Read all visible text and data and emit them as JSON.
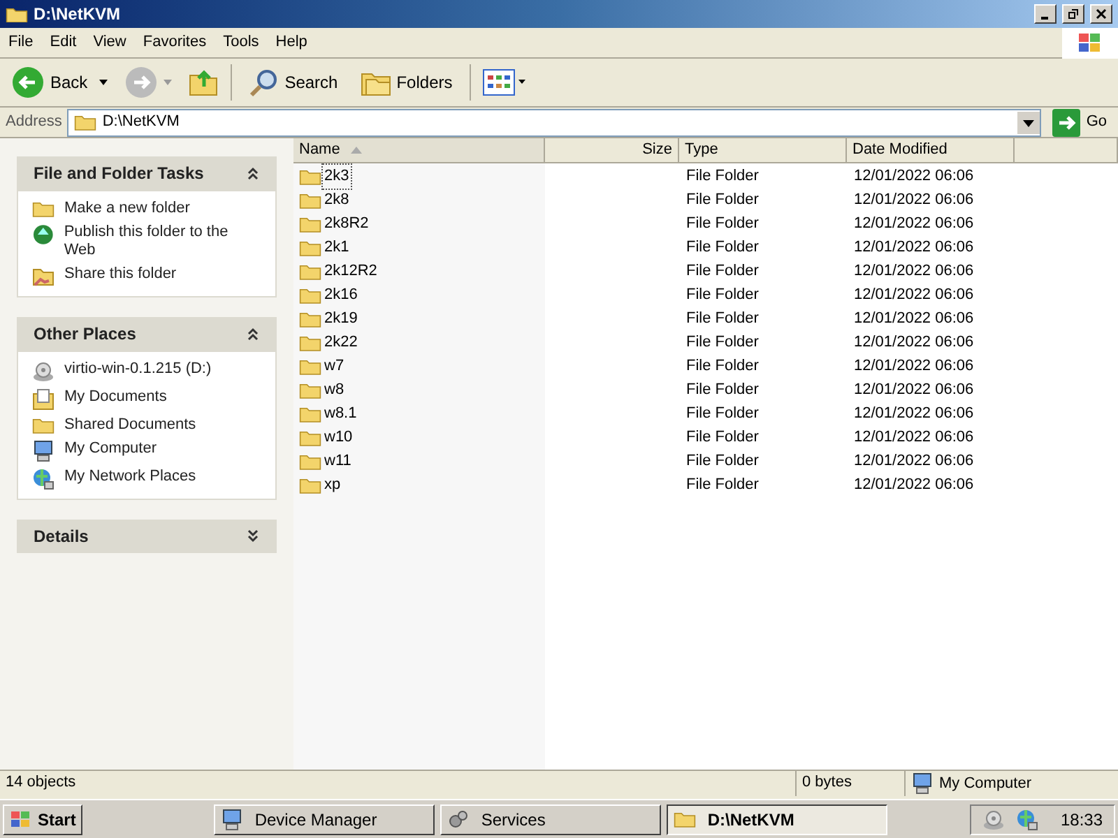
{
  "window": {
    "title": "D:\\NetKVM"
  },
  "menu": [
    "File",
    "Edit",
    "View",
    "Favorites",
    "Tools",
    "Help"
  ],
  "toolbar": {
    "back": "Back",
    "search": "Search",
    "folders": "Folders"
  },
  "address": {
    "label": "Address",
    "value": "D:\\NetKVM",
    "go": "Go"
  },
  "panels": [
    {
      "title": "File and Folder Tasks",
      "expanded": true,
      "items": [
        {
          "label": "Make a new folder",
          "kind": "newfolder"
        },
        {
          "label": "Publish this folder to the Web",
          "kind": "globe"
        },
        {
          "label": "Share this folder",
          "kind": "share"
        }
      ]
    },
    {
      "title": "Other Places",
      "expanded": true,
      "items": [
        {
          "label": "virtio-win-0.1.215 (D:)",
          "kind": "disc"
        },
        {
          "label": "My Documents",
          "kind": "docs"
        },
        {
          "label": "Shared Documents",
          "kind": "folder"
        },
        {
          "label": "My Computer",
          "kind": "computer"
        },
        {
          "label": "My Network Places",
          "kind": "network"
        }
      ]
    },
    {
      "title": "Details",
      "expanded": false
    }
  ],
  "table": {
    "columns": [
      {
        "label": "Name",
        "sorted": true
      },
      {
        "label": "Size",
        "sorted": false
      },
      {
        "label": "Type",
        "sorted": false
      },
      {
        "label": "Date Modified",
        "sorted": false
      }
    ],
    "rows": [
      {
        "name": "2k3",
        "type": "File Folder",
        "date": "12/01/2022 06:06",
        "focused": true
      },
      {
        "name": "2k8",
        "type": "File Folder",
        "date": "12/01/2022 06:06",
        "focused": false
      },
      {
        "name": "2k8R2",
        "type": "File Folder",
        "date": "12/01/2022 06:06",
        "focused": false
      },
      {
        "name": "2k1",
        "type": "File Folder",
        "date": "12/01/2022 06:06",
        "focused": false
      },
      {
        "name": "2k12R2",
        "type": "File Folder",
        "date": "12/01/2022 06:06",
        "focused": false
      },
      {
        "name": "2k16",
        "type": "File Folder",
        "date": "12/01/2022 06:06",
        "focused": false
      },
      {
        "name": "2k19",
        "type": "File Folder",
        "date": "12/01/2022 06:06",
        "focused": false
      },
      {
        "name": "2k22",
        "type": "File Folder",
        "date": "12/01/2022 06:06",
        "focused": false
      },
      {
        "name": "w7",
        "type": "File Folder",
        "date": "12/01/2022 06:06",
        "focused": false
      },
      {
        "name": "w8",
        "type": "File Folder",
        "date": "12/01/2022 06:06",
        "focused": false
      },
      {
        "name": "w8.1",
        "type": "File Folder",
        "date": "12/01/2022 06:06",
        "focused": false
      },
      {
        "name": "w10",
        "type": "File Folder",
        "date": "12/01/2022 06:06",
        "focused": false
      },
      {
        "name": "w11",
        "type": "File Folder",
        "date": "12/01/2022 06:06",
        "focused": false
      },
      {
        "name": "xp",
        "type": "File Folder",
        "date": "12/01/2022 06:06",
        "focused": false
      }
    ]
  },
  "status_bar": {
    "objects": "14 objects",
    "size": "0 bytes",
    "location": "My Computer"
  },
  "taskbar": {
    "start": "Start",
    "tasks": [
      {
        "label": "Device Manager",
        "kind": "computer",
        "selected": false
      },
      {
        "label": "Services",
        "kind": "gears",
        "selected": false
      },
      {
        "label": "D:\\NetKVM",
        "kind": "folder",
        "selected": true
      }
    ],
    "clock": "18:33"
  }
}
